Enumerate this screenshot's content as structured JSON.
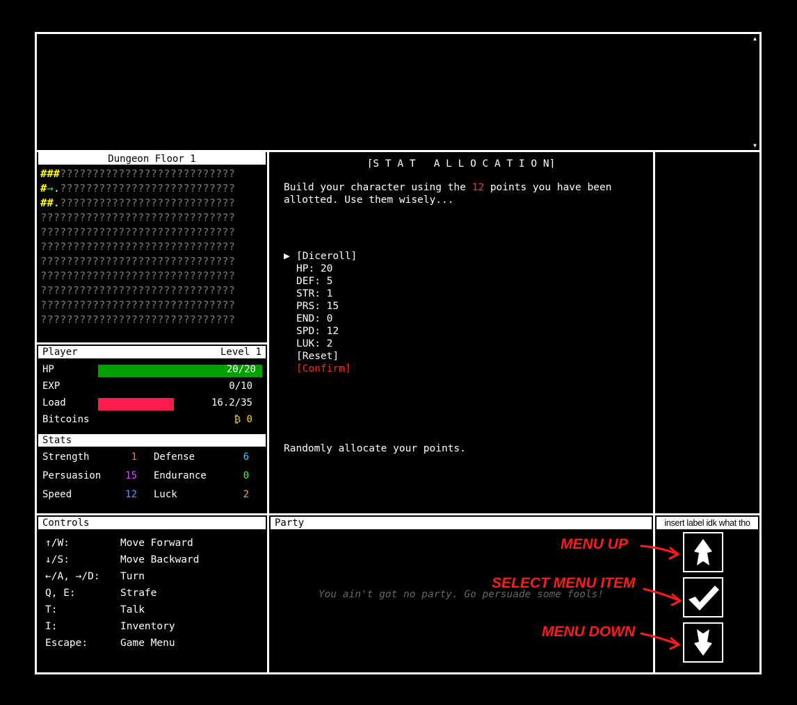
{
  "map": {
    "title": "Dungeon Floor 1",
    "rows": [
      [
        {
          "t": "###",
          "c": "y"
        },
        {
          "t": "???????????????????????????",
          "c": "q"
        }
      ],
      [
        {
          "t": "#",
          "c": "y"
        },
        {
          "t": "→",
          "c": "g"
        },
        {
          "t": ".",
          "c": "w"
        },
        {
          "t": "???????????????????????????",
          "c": "q"
        }
      ],
      [
        {
          "t": "##",
          "c": "y"
        },
        {
          "t": ".",
          "c": "w"
        },
        {
          "t": "???????????????????????????",
          "c": "q"
        }
      ],
      [
        {
          "t": "??????????????????????????????",
          "c": "q"
        }
      ],
      [
        {
          "t": "??????????????????????????????",
          "c": "q"
        }
      ],
      [
        {
          "t": "??????????????????????????????",
          "c": "q"
        }
      ],
      [
        {
          "t": "??????????????????????????????",
          "c": "q"
        }
      ],
      [
        {
          "t": "??????????????????????????????",
          "c": "q"
        }
      ],
      [
        {
          "t": "??????????????????????????????",
          "c": "q"
        }
      ],
      [
        {
          "t": "??????????????????????????????",
          "c": "q"
        }
      ],
      [
        {
          "t": "??????????????????????????????",
          "c": "q"
        }
      ]
    ]
  },
  "player": {
    "title": "Player",
    "level": "Level 1",
    "hp_label": "HP",
    "hp_value": "20/20",
    "hp_fraction": 1.0,
    "exp_label": "EXP",
    "exp_value": "0/10",
    "load_label": "Load",
    "load_value": "16.2/35",
    "load_fraction": 0.463,
    "bitcoins_label": "Bitcoins",
    "bitcoins_value": "₿ 0",
    "colors": {
      "hp_bar": "#00a000",
      "load_bar": "#ff1a4d",
      "bitcoin": "#ffd700"
    }
  },
  "stats": {
    "title": "Stats",
    "items": [
      {
        "label": "Strength",
        "value": "1",
        "color": "#ff6a4d"
      },
      {
        "label": "Defense",
        "value": "6",
        "color": "#33ccff"
      },
      {
        "label": "Persuasion",
        "value": "15",
        "color": "#cc55ff"
      },
      {
        "label": "Endurance",
        "value": "0",
        "color": "#33ff55"
      },
      {
        "label": "Speed",
        "value": "12",
        "color": "#5599ff"
      },
      {
        "label": "Luck",
        "value": "2",
        "color": "#ffaa33"
      }
    ]
  },
  "allocation": {
    "title": "⌈S T A T   A L L O C A T I O N⌉",
    "intro_pre": "Build your character using the ",
    "intro_points": "12",
    "intro_post_line1": " points you have been",
    "intro_line2": "allotted. Use them wisely...",
    "cursor": "▶",
    "menu": [
      {
        "label": "[Diceroll]",
        "selected": true
      },
      {
        "label": "HP: 20"
      },
      {
        "label": "DEF: 5"
      },
      {
        "label": "STR: 1"
      },
      {
        "label": "PRS: 15"
      },
      {
        "label": "END: 0"
      },
      {
        "label": "SPD: 12"
      },
      {
        "label": "LUK: 2"
      },
      {
        "label": "[Reset]"
      },
      {
        "label": "[Confirm]",
        "danger": true
      }
    ],
    "help": "Randomly allocate your points.",
    "colors": {
      "points": "#ff3333",
      "confirm": "#ff2222"
    }
  },
  "controls": {
    "title": "Controls",
    "items": [
      {
        "key": "↑/W:",
        "action": "Move Forward"
      },
      {
        "key": "↓/S:",
        "action": "Move Backward"
      },
      {
        "key": "←/A, →/D:",
        "action": "Turn"
      },
      {
        "key": "Q, E:",
        "action": "Strafe"
      },
      {
        "key": "T:",
        "action": "Talk"
      },
      {
        "key": "I:",
        "action": "Inventory"
      },
      {
        "key": "Escape:",
        "action": "Game Menu"
      }
    ]
  },
  "party": {
    "title": "Party",
    "empty_text": "You ain't got no party. Go persuade some fools!"
  },
  "side": {
    "label": "insert label idk what tho",
    "annotations": {
      "up": "MENU UP",
      "select": "SELECT MENU ITEM",
      "down": "MENU DOWN"
    }
  }
}
